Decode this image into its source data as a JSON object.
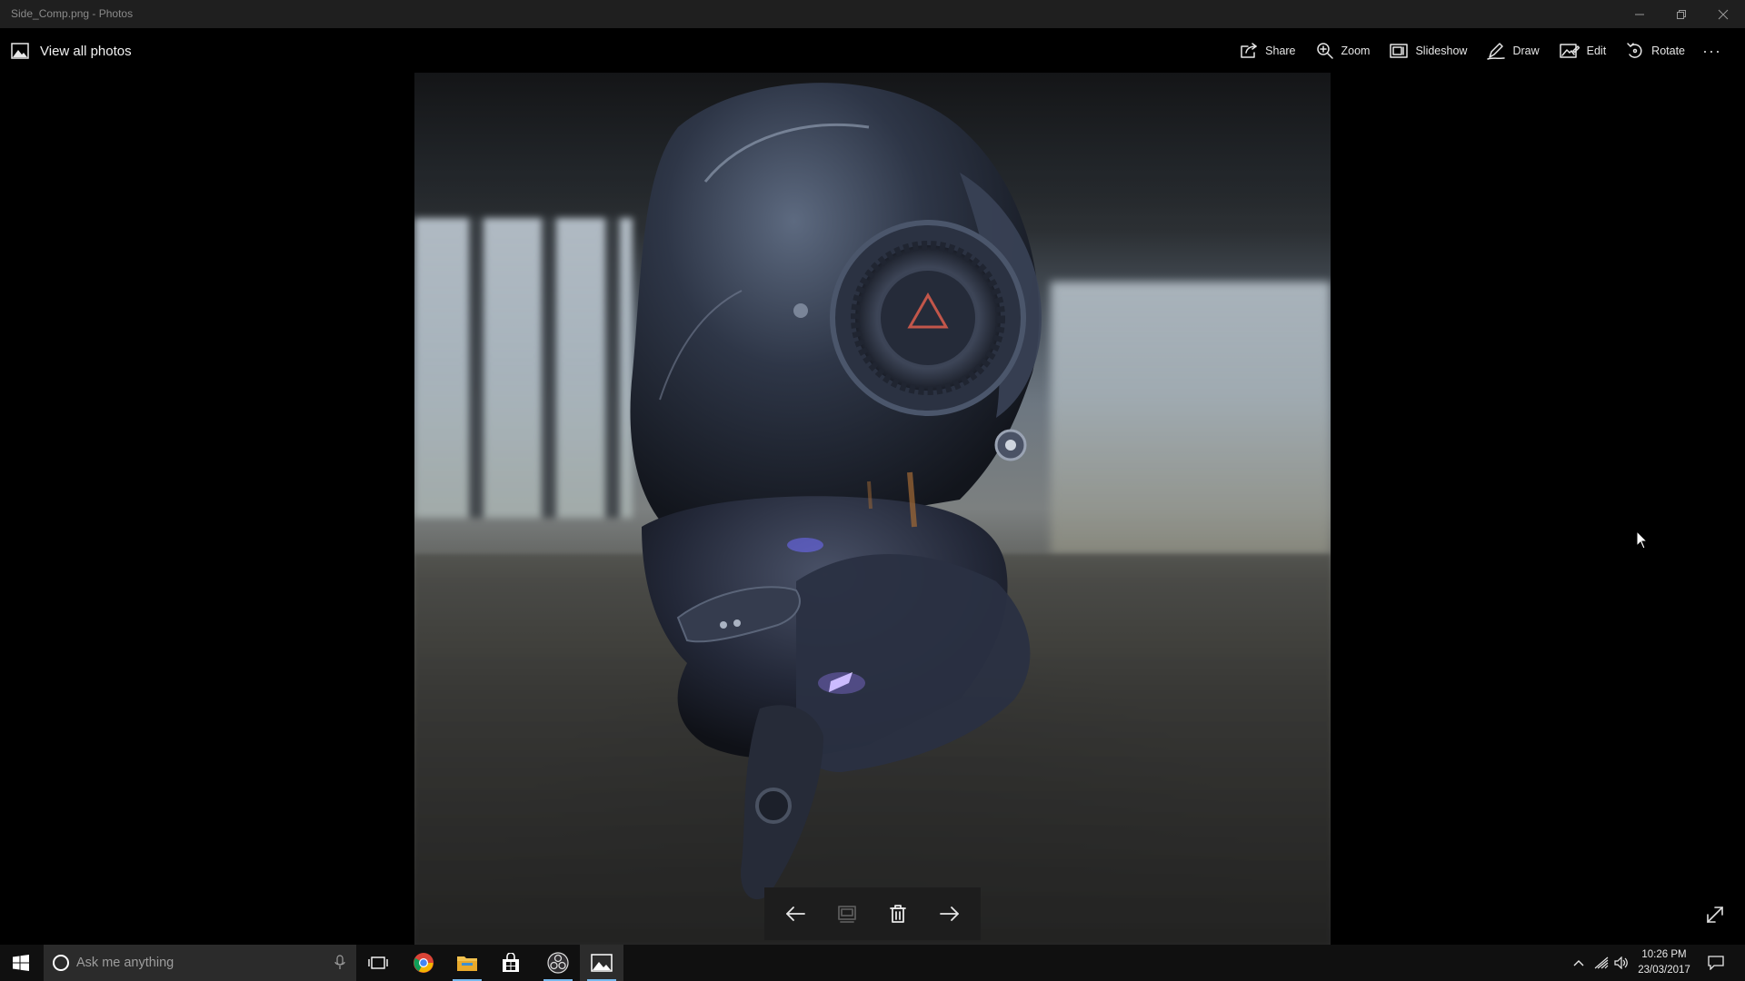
{
  "window": {
    "title": "Side_Comp.png - Photos"
  },
  "commandbar": {
    "back_label": "View all photos",
    "commands": [
      {
        "label": "Share",
        "icon": "share-icon"
      },
      {
        "label": "Zoom",
        "icon": "zoom-icon"
      },
      {
        "label": "Slideshow",
        "icon": "slideshow-icon"
      },
      {
        "label": "Draw",
        "icon": "draw-icon"
      },
      {
        "label": "Edit",
        "icon": "edit-icon"
      },
      {
        "label": "Rotate",
        "icon": "rotate-icon"
      }
    ],
    "more_label": "···"
  },
  "photo": {
    "subject": "Sci-fi helmet render in an industrial interior"
  },
  "photo_nav": {
    "buttons": [
      "previous-icon",
      "add-to-album-icon",
      "delete-icon",
      "next-icon"
    ]
  },
  "taskbar": {
    "search_placeholder": "Ask me anything",
    "apps": [
      "task-view-icon",
      "chrome-icon",
      "file-explorer-icon",
      "store-icon",
      "obs-icon",
      "photos-icon"
    ],
    "clock_time": "10:26 PM",
    "clock_date": "23/03/2017"
  },
  "colors": {
    "accent": "#76b9ed",
    "titlebar": "#1f1f1f",
    "taskbar": "#101010"
  }
}
